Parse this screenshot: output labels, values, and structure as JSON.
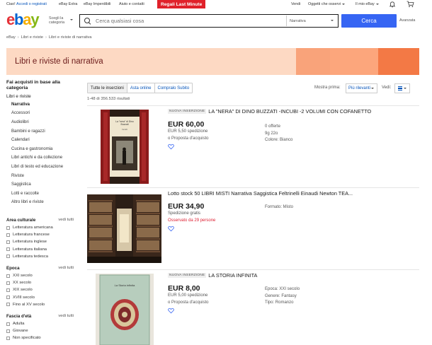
{
  "topbar": {
    "greeting": "Ciao!",
    "signin": "Accedi o registrati",
    "links": [
      "eBay Extra",
      "eBay Imperdibili",
      "Aiuto e contatti"
    ],
    "promo": "Regali Last Minute",
    "right": {
      "sell": "Vendi",
      "watchlist": "Oggetti che osservi",
      "myebay": "Il mio eBay"
    }
  },
  "header": {
    "logo": {
      "e": "e",
      "b": "b",
      "a": "a",
      "y": "y"
    },
    "shop_by_category": "Scegli la categoria",
    "search_placeholder": "Cerca qualsiasi cosa",
    "search_category": "Narrativa",
    "search_button": "Cerca",
    "advanced": "Avanzata"
  },
  "breadcrumb": [
    "eBay",
    "Libri e riviste",
    "Libri e riviste di narrativa"
  ],
  "banner": {
    "title": "Libri e riviste di narrativa"
  },
  "sidebar": {
    "heading": "Fai acquisti in base alla categoria",
    "parent": "Libri e riviste",
    "categories": [
      "Narrativa",
      "Accessori",
      "Audiolibri",
      "Bambini e ragazzi",
      "Calendari",
      "Cucina e gastronomia",
      "Libri antichi e da collezione",
      "Libri di testo ed educazione",
      "Riviste",
      "Saggistica",
      "Lotti e raccolte",
      "Altro libri e riviste"
    ],
    "see_all": "vedi tutti",
    "facets": [
      {
        "title": "Area culturale",
        "options": [
          "Letteratura americana",
          "Letteratura francese",
          "Letteratura inglese",
          "Letteratura italiana",
          "Letteratura tedesca"
        ]
      },
      {
        "title": "Epoca",
        "options": [
          "XXI secolo",
          "XX secolo",
          "XIX secolo",
          "XVIII secolo",
          "Fino al XV secolo"
        ]
      },
      {
        "title": "Fascia d'età",
        "options": [
          "Adulta",
          "Giovane",
          "Non specificato"
        ]
      }
    ]
  },
  "toolbar": {
    "tabs": [
      "Tutte le inserzioni",
      "Asta online",
      "Compralo Subito"
    ],
    "sort_label": "Mostra prima:",
    "sort_value": "Più rilevanti",
    "view_label": "Vedi:",
    "results": "1-48 di 356.533 risultati"
  },
  "listings": [
    {
      "badge": "NUOVA INSERZIONE",
      "title": "LA \"NERA\" DI DINO BUZZATI -INCUBI -2 VOLUMI CON COFANETTO",
      "price": "EUR 60,00",
      "lines": [
        "EUR 5,50 spedizione",
        "o Proposta d'acquisto"
      ],
      "attrs": [
        "0 offerte",
        "9g 22o",
        "Colore: Bianco"
      ],
      "cover_title": "La \"nera\" di Dino Buzzati",
      "cover_sub": "Incubi"
    },
    {
      "badge": "",
      "title": "Lotto stock 50 LIBRI MISTI Narrativa Saggistica Feltrinelli Einaudi Newton TEA...",
      "price": "EUR 34,90",
      "lines": [
        "Spedizione gratis"
      ],
      "watched": "Osservato da 29 persone",
      "attrs": [
        "Formato: Misto"
      ]
    },
    {
      "badge": "NUOVA INSERZIONE",
      "title": "LA STORIA INFINITA",
      "price": "EUR 8,00",
      "lines": [
        "EUR 5,00 spedizione",
        "o Proposta d'acquisto"
      ],
      "attrs": [
        "Epoca: XXI secolo",
        "Genere: Fantasy",
        "Tipo: Romanzo"
      ],
      "cover_title": "La Storia infinita"
    }
  ],
  "colors": {
    "accent": "#3665f3",
    "link": "#0654ba",
    "banner": "#fdd9c3",
    "promo": "#e0212a",
    "watched": "#dd1e31"
  }
}
